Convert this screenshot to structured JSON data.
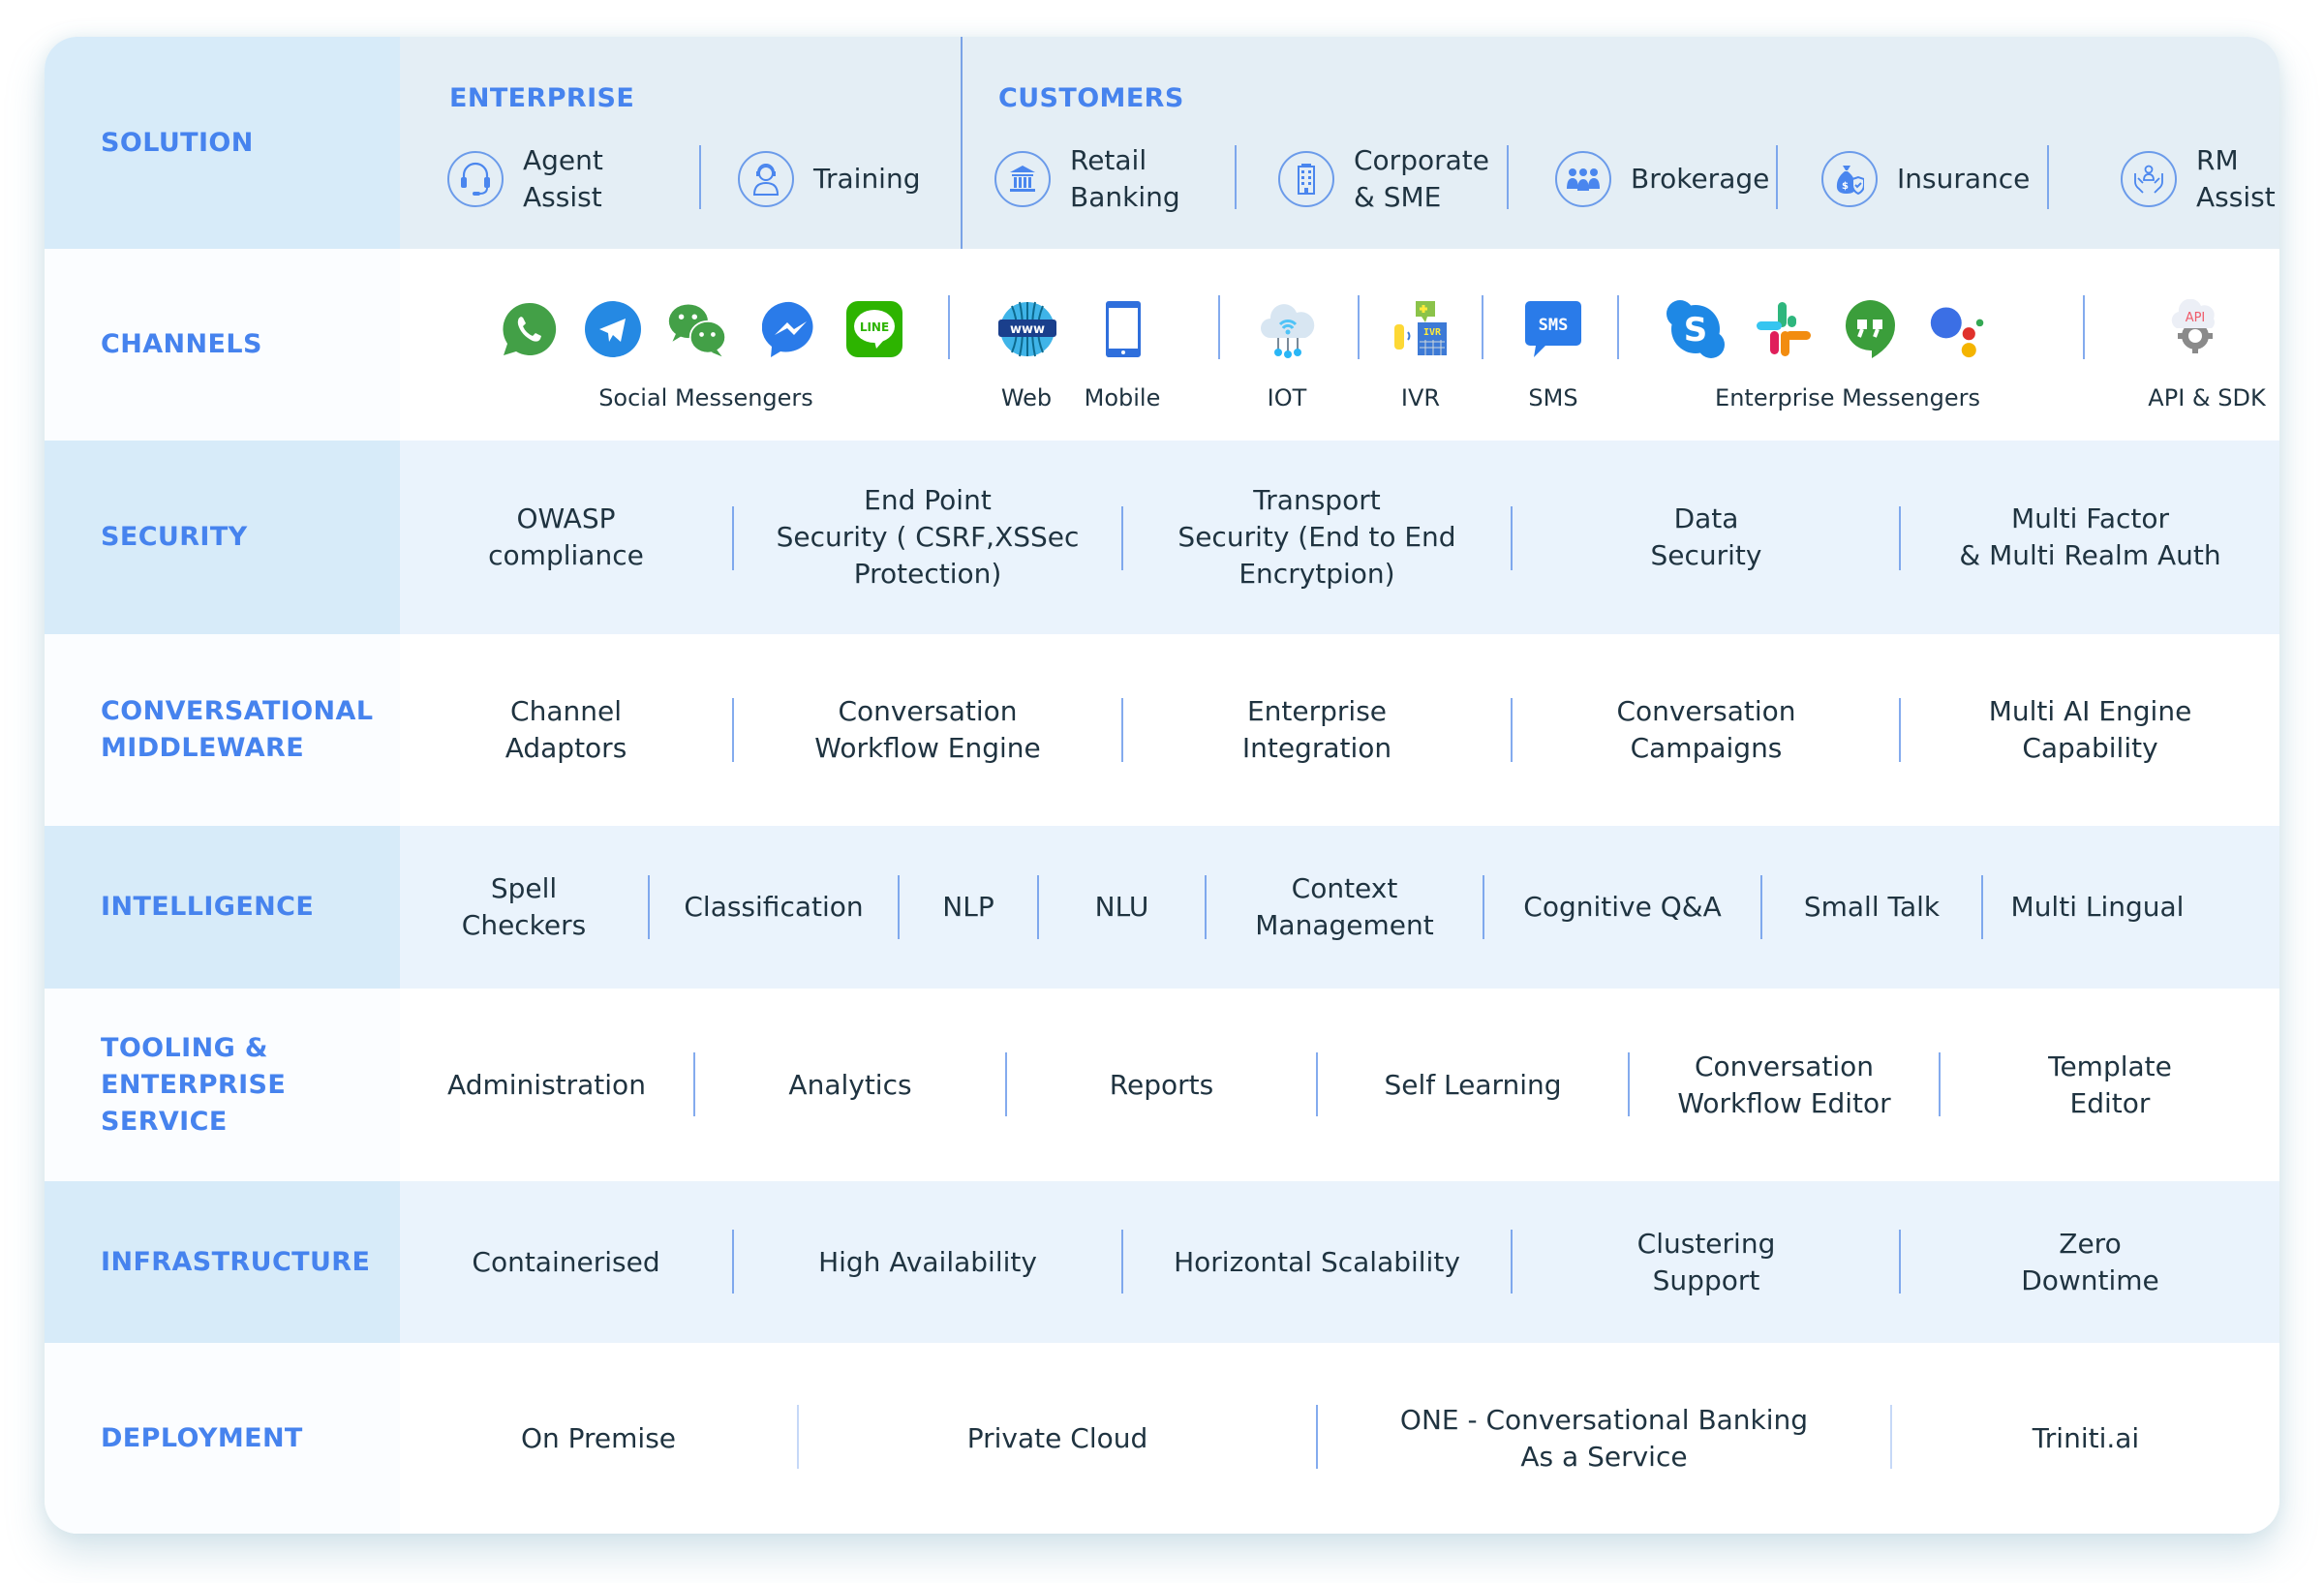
{
  "colors": {
    "heading": "#4683EE",
    "text": "#1F3340",
    "divider": "#5B8FE8",
    "label_bg_blue": "#D7EBF9",
    "content_bg_blue": "#EAF3FC",
    "solution_bg": "#E4EEF5"
  },
  "solution": {
    "label": "SOLUTION",
    "enterprise": {
      "title": "ENTERPRISE",
      "items": [
        {
          "label": "Agent\nAssist",
          "icon": "headset-icon"
        },
        {
          "label": "Training",
          "icon": "trainer-icon"
        }
      ]
    },
    "customers": {
      "title": "CUSTOMERS",
      "items": [
        {
          "label": "Retail\nBanking",
          "icon": "bank-icon"
        },
        {
          "label": "Corporate\n& SME",
          "icon": "building-icon"
        },
        {
          "label": "Brokerage",
          "icon": "group-icon"
        },
        {
          "label": "Insurance",
          "icon": "money-bag-shield-icon"
        },
        {
          "label": "RM\nAssist",
          "icon": "hands-person-icon"
        }
      ]
    }
  },
  "channels": {
    "label": "CHANNELS",
    "groups": [
      {
        "label": "Social Messengers",
        "icons": [
          "whatsapp-icon",
          "telegram-icon",
          "wechat-icon",
          "messenger-icon",
          "line-icon"
        ]
      },
      {
        "label": "Web",
        "icons": [
          "www-globe-icon"
        ]
      },
      {
        "label": "Mobile",
        "icons": [
          "mobile-phone-icon"
        ]
      },
      {
        "label": "IOT",
        "icons": [
          "iot-cloud-icon"
        ]
      },
      {
        "label": "IVR",
        "icons": [
          "ivr-icon"
        ]
      },
      {
        "label": "SMS",
        "icons": [
          "sms-icon"
        ]
      },
      {
        "label": "Enterprise Messengers",
        "icons": [
          "skype-icon",
          "slack-icon",
          "hangouts-icon",
          "google-assistant-icon"
        ]
      },
      {
        "label": "API & SDK",
        "icons": [
          "api-gear-icon"
        ]
      }
    ],
    "icon_text": {
      "line": "LINE",
      "www": "www",
      "ivr": "IVR",
      "sms": "SMS",
      "api": "API"
    }
  },
  "security": {
    "label": "SECURITY",
    "items": [
      "OWASP\ncompliance",
      "End Point\nSecurity ( CSRF,XSSec\nProtection)",
      "Transport\nSecurity (End to End\nEncrytpion)",
      "Data\nSecurity",
      "Multi Factor\n& Multi Realm Auth"
    ]
  },
  "middleware": {
    "label": "CONVERSATIONAL\nMIDDLEWARE",
    "items": [
      "Channel\nAdaptors",
      "Conversation\nWorkflow Engine",
      "Enterprise\nIntegration",
      "Conversation\nCampaigns",
      "Multi AI Engine\nCapability"
    ]
  },
  "intelligence": {
    "label": "INTELLIGENCE",
    "items": [
      "Spell\nCheckers",
      "Classification",
      "NLP",
      "NLU",
      "Context\nManagement",
      "Cognitive Q&A",
      "Small Talk",
      "Multi Lingual"
    ]
  },
  "tooling": {
    "label": "TOOLING &\nENTERPRISE\nSERVICE",
    "items": [
      "Administration",
      "Analytics",
      "Reports",
      "Self Learning",
      "Conversation\nWorkflow Editor",
      "Template\nEditor"
    ]
  },
  "infrastructure": {
    "label": "INFRASTRUCTURE",
    "items": [
      "Containerised",
      "High Availability",
      "Horizontal Scalability",
      "Clustering\nSupport",
      "Zero\nDowntime"
    ]
  },
  "deployment": {
    "label": "DEPLOYMENT",
    "items": [
      "On Premise",
      "Private Cloud",
      "ONE - Conversational Banking\nAs  a Service",
      "Triniti.ai"
    ]
  }
}
